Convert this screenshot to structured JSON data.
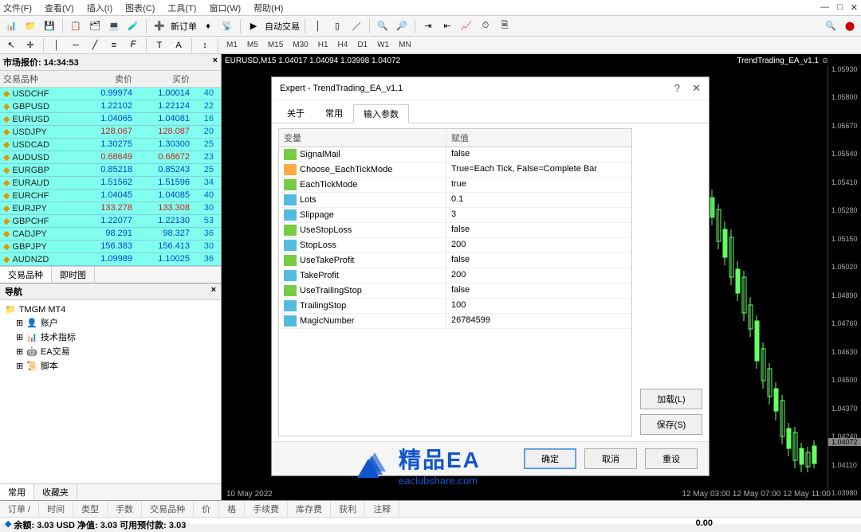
{
  "menu": [
    "文件(F)",
    "查看(V)",
    "插入(I)",
    "图表(C)",
    "工具(T)",
    "窗口(W)",
    "帮助(H)"
  ],
  "toolbar_labels": {
    "new_order": "新订单",
    "auto_trade": "自动交易"
  },
  "timeframes": [
    "M1",
    "M5",
    "M15",
    "M30",
    "H1",
    "H4",
    "D1",
    "W1",
    "MN"
  ],
  "market_watch": {
    "title": "市场报价:",
    "time": "14:34:53",
    "cols": [
      "交易品种",
      "卖价",
      "买价"
    ],
    "rows": [
      {
        "s": "USDCHF",
        "b": "0.99974",
        "a": "1.00014",
        "p": "40",
        "c": "b"
      },
      {
        "s": "GBPUSD",
        "b": "1.22102",
        "a": "1.22124",
        "p": "22",
        "c": "b"
      },
      {
        "s": "EURUSD",
        "b": "1.04065",
        "a": "1.04081",
        "p": "16",
        "c": "b"
      },
      {
        "s": "USDJPY",
        "b": "128.067",
        "a": "128.087",
        "p": "20",
        "c": "r"
      },
      {
        "s": "USDCAD",
        "b": "1.30275",
        "a": "1.30300",
        "p": "25",
        "c": "b"
      },
      {
        "s": "AUDUSD",
        "b": "0.68649",
        "a": "0.68672",
        "p": "23",
        "c": "r"
      },
      {
        "s": "EURGBP",
        "b": "0.85218",
        "a": "0.85243",
        "p": "25",
        "c": "b"
      },
      {
        "s": "EURAUD",
        "b": "1.51562",
        "a": "1.51596",
        "p": "34",
        "c": "b"
      },
      {
        "s": "EURCHF",
        "b": "1.04045",
        "a": "1.04085",
        "p": "40",
        "c": "b"
      },
      {
        "s": "EURJPY",
        "b": "133.278",
        "a": "133.308",
        "p": "30",
        "c": "r"
      },
      {
        "s": "GBPCHF",
        "b": "1.22077",
        "a": "1.22130",
        "p": "53",
        "c": "b"
      },
      {
        "s": "CADJPY",
        "b": "98.291",
        "a": "98.327",
        "p": "36",
        "c": "b"
      },
      {
        "s": "GBPJPY",
        "b": "156.383",
        "a": "156.413",
        "p": "30",
        "c": "b"
      },
      {
        "s": "AUDNZD",
        "b": "1.09989",
        "a": "1.10025",
        "p": "36",
        "c": "b"
      }
    ],
    "tabs": [
      "交易品种",
      "即时图"
    ]
  },
  "navigator": {
    "title": "导航",
    "root": "TMGM MT4",
    "items": [
      "账户",
      "技术指标",
      "EA交易",
      "脚本"
    ],
    "tabs": [
      "常用",
      "收藏夹"
    ]
  },
  "chart": {
    "title": "EURUSD,M15  1.04017 1.04094 1.03998 1.04072",
    "ea": "TrendTrading_EA_v1.1 ☺",
    "date": "10 May 2022",
    "dates": "12 May 03:00   12 May 07:00   12 May 11:00",
    "prices": [
      "1.05930",
      "1.05800",
      "1.05670",
      "1.05540",
      "1.05410",
      "1.05280",
      "1.05150",
      "1.05020",
      "1.04890",
      "1.04760",
      "1.04630",
      "1.04500",
      "1.04370",
      "1.04240",
      "1.04110",
      "1.03980"
    ],
    "cur_price": "1.04072"
  },
  "dialog": {
    "title": "Expert - TrendTrading_EA_v1.1",
    "tabs": [
      "关于",
      "常用",
      "输入参数"
    ],
    "param_head": [
      "变量",
      "赋值"
    ],
    "params": [
      {
        "v": "SignalMail",
        "val": "false",
        "t": "bool"
      },
      {
        "v": "Choose_EachTickMode",
        "val": "True=Each Tick, False=Complete Bar",
        "t": "str"
      },
      {
        "v": "EachTickMode",
        "val": "true",
        "t": "bool"
      },
      {
        "v": "Lots",
        "val": "0.1",
        "t": "num"
      },
      {
        "v": "Slippage",
        "val": "3",
        "t": "num"
      },
      {
        "v": "UseStopLoss",
        "val": "false",
        "t": "bool"
      },
      {
        "v": "StopLoss",
        "val": "200",
        "t": "num"
      },
      {
        "v": "UseTakeProfit",
        "val": "false",
        "t": "bool"
      },
      {
        "v": "TakeProfit",
        "val": "200",
        "t": "num"
      },
      {
        "v": "UseTrailingStop",
        "val": "false",
        "t": "bool"
      },
      {
        "v": "TrailingStop",
        "val": "100",
        "t": "num"
      },
      {
        "v": "MagicNumber",
        "val": "26784599",
        "t": "num"
      }
    ],
    "side_buttons": [
      "加载(L)",
      "保存(S)"
    ],
    "foot_buttons": [
      "确定",
      "取消",
      "重设"
    ]
  },
  "terminal": {
    "cols": [
      "订单 /",
      "时间",
      "类型",
      "手数",
      "交易品种",
      "价",
      "格",
      "手续费",
      "库存费",
      "获利",
      "注释"
    ],
    "balance": "余额: 3.03 USD  净值: 3.03  可用预付款: 3.03",
    "profit": "0.00"
  },
  "logo": {
    "brand": "精品EA",
    "url": "eaclubshare.com"
  },
  "win_controls": {
    "min": "—",
    "max": "□",
    "close": "✕"
  }
}
